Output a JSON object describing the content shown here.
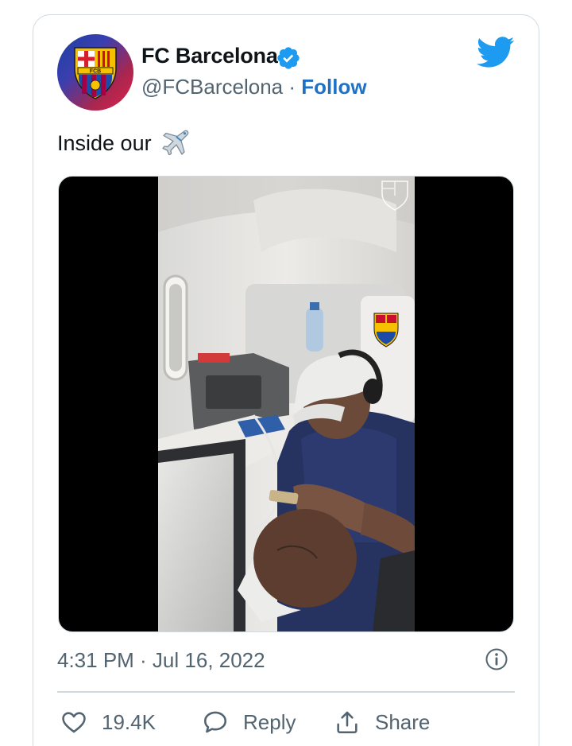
{
  "tweet": {
    "author": {
      "display_name": "FC Barcelona",
      "handle": "@FCBarcelona",
      "separator": "·",
      "follow_label": "Follow",
      "verified": true,
      "avatar_crest_text": "FCB"
    },
    "text": "Inside our",
    "text_emoji": "airplane",
    "timestamp": "4:31 PM · Jul 16, 2022",
    "actions": {
      "likes_count": "19.4K",
      "reply_label": "Reply",
      "share_label": "Share"
    }
  },
  "colors": {
    "link_blue": "#1d72c6",
    "twitter_blue": "#1d9bf0",
    "muted_text": "#536471",
    "border": "#cfd9de"
  },
  "icons": [
    "twitter-bird-icon",
    "verified-badge-icon",
    "airplane-emoji-icon",
    "info-icon",
    "heart-icon",
    "reply-bubble-icon",
    "share-icon"
  ]
}
